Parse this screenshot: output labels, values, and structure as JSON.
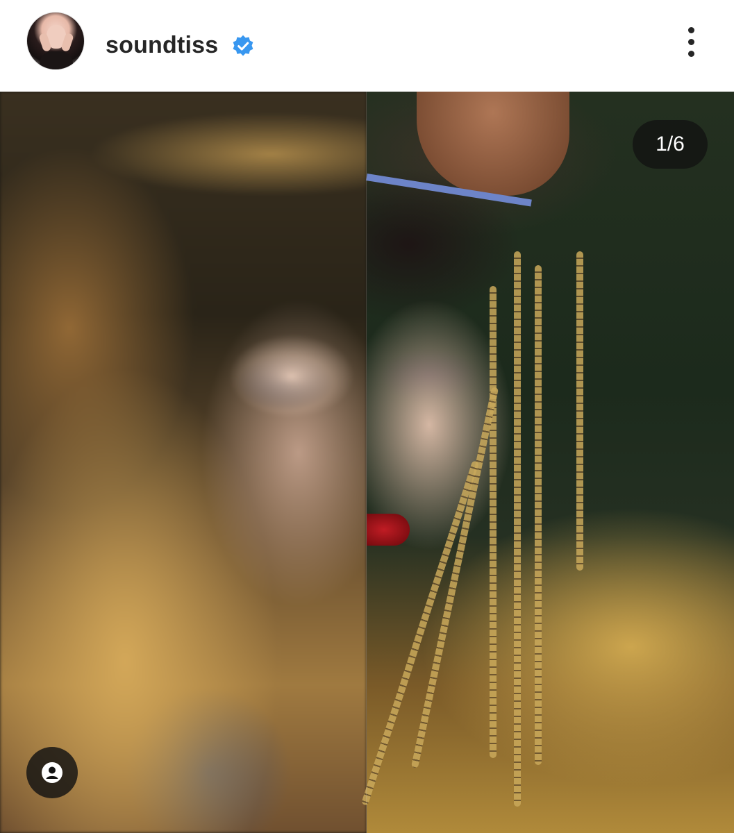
{
  "post": {
    "header": {
      "username": "soundtiss",
      "verified": true,
      "avatar_icon": "profile-avatar",
      "more_icon": "more-vertical-icon"
    },
    "media": {
      "counter_text": "1/6",
      "current_slide": 1,
      "total_slides": 6,
      "tag_icon": "user-tag-icon"
    }
  },
  "colors": {
    "verified_badge": "#3897f0",
    "username_text": "#262626",
    "overlay_bg": "#121212"
  }
}
